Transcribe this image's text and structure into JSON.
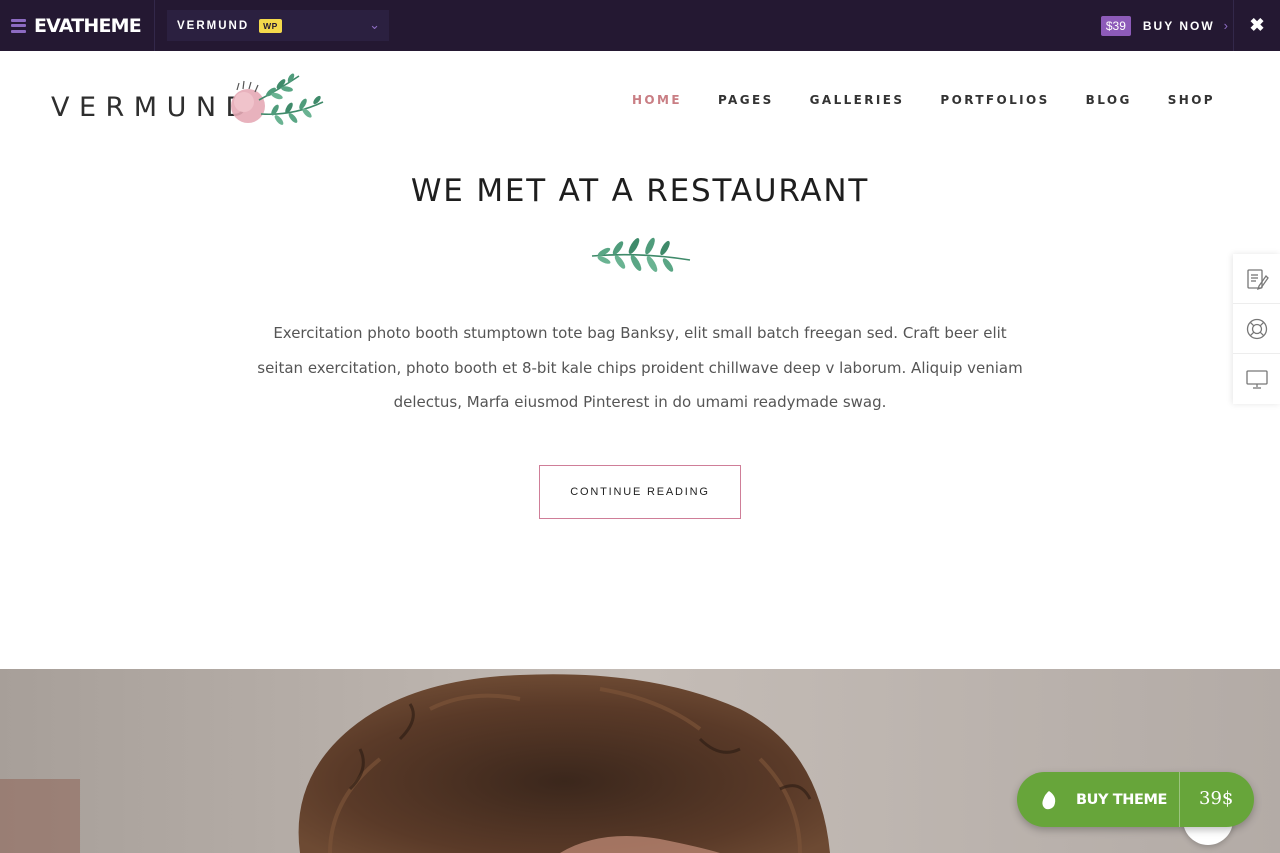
{
  "topbar": {
    "brand": "EVATHEME",
    "theme_name": "VERMUND",
    "theme_badge": "WP",
    "price": "$39",
    "buy_label": "BUY NOW"
  },
  "site": {
    "logo_text": "VERMUND"
  },
  "nav": {
    "items": [
      "HOME",
      "PAGES",
      "GALLERIES",
      "PORTFOLIOS",
      "BLOG",
      "SHOP"
    ],
    "active": "HOME"
  },
  "post": {
    "title": "WE MET AT A RESTAURANT",
    "excerpt_lines": [
      "Exercitation photo booth stumptown tote bag Banksy, elit small batch freegan sed. Craft beer elit",
      "seitan exercitation, photo booth et 8-bit kale chips proident chillwave deep v laborum. Aliquip veniam",
      "delectus, Marfa eiusmod Pinterest in do umami readymade swag."
    ],
    "continue_label": "CONTINUE READING"
  },
  "side_tools": [
    "document-edit-icon",
    "lifebuoy-icon",
    "monitor-icon"
  ],
  "buy_float": {
    "label": "BUY THEME",
    "price": "39$"
  },
  "colors": {
    "topbar_bg": "#241832",
    "accent_purple": "#8d5bb9",
    "nav_active": "#c97e84",
    "button_border": "#cf7e98",
    "buy_green": "#67a53a"
  }
}
